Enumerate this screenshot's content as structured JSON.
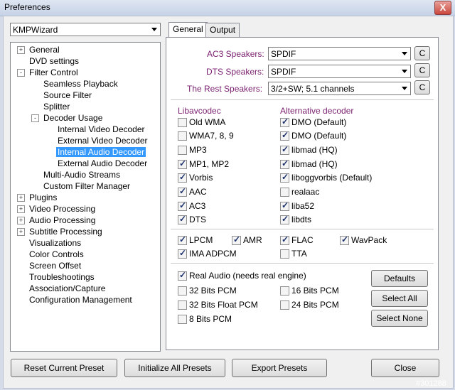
{
  "window": {
    "title": "Preferences",
    "close_glyph": "X"
  },
  "preset": {
    "selected": "KMPWizard"
  },
  "tree": {
    "items": [
      {
        "label": "General",
        "expander": "+"
      },
      {
        "label": "DVD settings"
      },
      {
        "label": "Filter Control",
        "expander": "-"
      },
      {
        "label": "Seamless Playback"
      },
      {
        "label": "Source Filter"
      },
      {
        "label": "Splitter"
      },
      {
        "label": "Decoder Usage",
        "expander": "-"
      },
      {
        "label": "Internal Video Decoder"
      },
      {
        "label": "External Video Decoder"
      },
      {
        "label": "Internal Audio Decoder",
        "selected": true
      },
      {
        "label": "External Audio Decoder"
      },
      {
        "label": "Multi-Audio Streams"
      },
      {
        "label": "Custom Filter Manager"
      },
      {
        "label": "Plugins",
        "expander": "+"
      },
      {
        "label": "Video Processing",
        "expander": "+"
      },
      {
        "label": "Audio Processing",
        "expander": "+"
      },
      {
        "label": "Subtitle Processing",
        "expander": "+"
      },
      {
        "label": "Visualizations"
      },
      {
        "label": "Color Controls"
      },
      {
        "label": "Screen Offset"
      },
      {
        "label": "Troubleshootings"
      },
      {
        "label": "Association/Capture"
      },
      {
        "label": "Configuration Management"
      }
    ]
  },
  "tabs": [
    "General",
    "Output"
  ],
  "speakers": [
    {
      "label": "AC3 Speakers:",
      "value": "SPDIF",
      "config": "C"
    },
    {
      "label": "DTS Speakers:",
      "value": "SPDIF",
      "config": "C"
    },
    {
      "label": "The Rest Speakers:",
      "value": "3/2+SW; 5.1 channels",
      "config": "C"
    }
  ],
  "decoders": {
    "left_header": "Libavcodec",
    "right_header": "Alternative decoder",
    "rows": [
      {
        "left": "Old WMA",
        "left_on": false,
        "right": "DMO (Default)",
        "right_on": true
      },
      {
        "left": "WMA7, 8, 9",
        "left_on": false,
        "right": "DMO (Default)",
        "right_on": true
      },
      {
        "left": "MP3",
        "left_on": false,
        "right": "libmad (HQ)",
        "right_on": true
      },
      {
        "left": "MP1, MP2",
        "left_on": true,
        "right": "libmad (HQ)",
        "right_on": true
      },
      {
        "left": "Vorbis",
        "left_on": true,
        "right": "liboggvorbis (Default)",
        "right_on": true
      },
      {
        "left": "AAC",
        "left_on": true,
        "right": "realaac",
        "right_on": false
      },
      {
        "left": "AC3",
        "left_on": true,
        "right": "liba52",
        "right_on": true
      },
      {
        "left": "DTS",
        "left_on": true,
        "right": "libdts",
        "right_on": true
      }
    ]
  },
  "extra_formats": [
    {
      "label": "LPCM",
      "on": true
    },
    {
      "label": "AMR",
      "on": true
    },
    {
      "label": "FLAC",
      "on": true
    },
    {
      "label": "WavPack",
      "on": true
    },
    {
      "label": "IMA ADPCM",
      "on": true
    },
    {
      "label": "TTA",
      "on": false
    }
  ],
  "other_formats": [
    {
      "label": "Real Audio (needs real engine)",
      "on": true
    },
    {
      "label": "32 Bits PCM",
      "on": false
    },
    {
      "label": "16 Bits PCM",
      "on": false
    },
    {
      "label": "32 Bits Float PCM",
      "on": false
    },
    {
      "label": "24 Bits PCM",
      "on": false
    },
    {
      "label": "8 Bits PCM",
      "on": false
    }
  ],
  "side_buttons": {
    "defaults": "Defaults",
    "select_all": "Select All",
    "select_none": "Select None"
  },
  "bottom_buttons": {
    "reset": "Reset Current Preset",
    "initialize": "Initialize All Presets",
    "export": "Export Presets",
    "close": "Close"
  },
  "watermark": "#301288"
}
